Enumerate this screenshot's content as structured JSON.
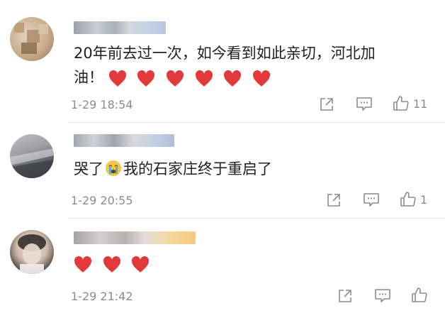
{
  "comments": [
    {
      "username": "",
      "text_line1": "20年前去过一次，如今看到如此亲切，河北加",
      "text_line2": "油！",
      "hearts": 6,
      "time": "1-29 18:54",
      "like_count": "11"
    },
    {
      "username": "",
      "text_before_emoji": "哭了",
      "emoji": "crying-face",
      "text_after_emoji": "我的石家庄终于重启了",
      "time": "1-29 20:55",
      "like_count": "1"
    },
    {
      "username": "",
      "hearts": 3,
      "time": "1-29 21:42",
      "like_count": ""
    }
  ],
  "icons": {
    "heart": "heart-icon",
    "share": "share-icon",
    "comment": "comment-icon",
    "like": "like-icon"
  },
  "colors": {
    "heart": "#e23a3a",
    "meta_text": "#8c8c8c",
    "divider": "#e6e6e6"
  }
}
